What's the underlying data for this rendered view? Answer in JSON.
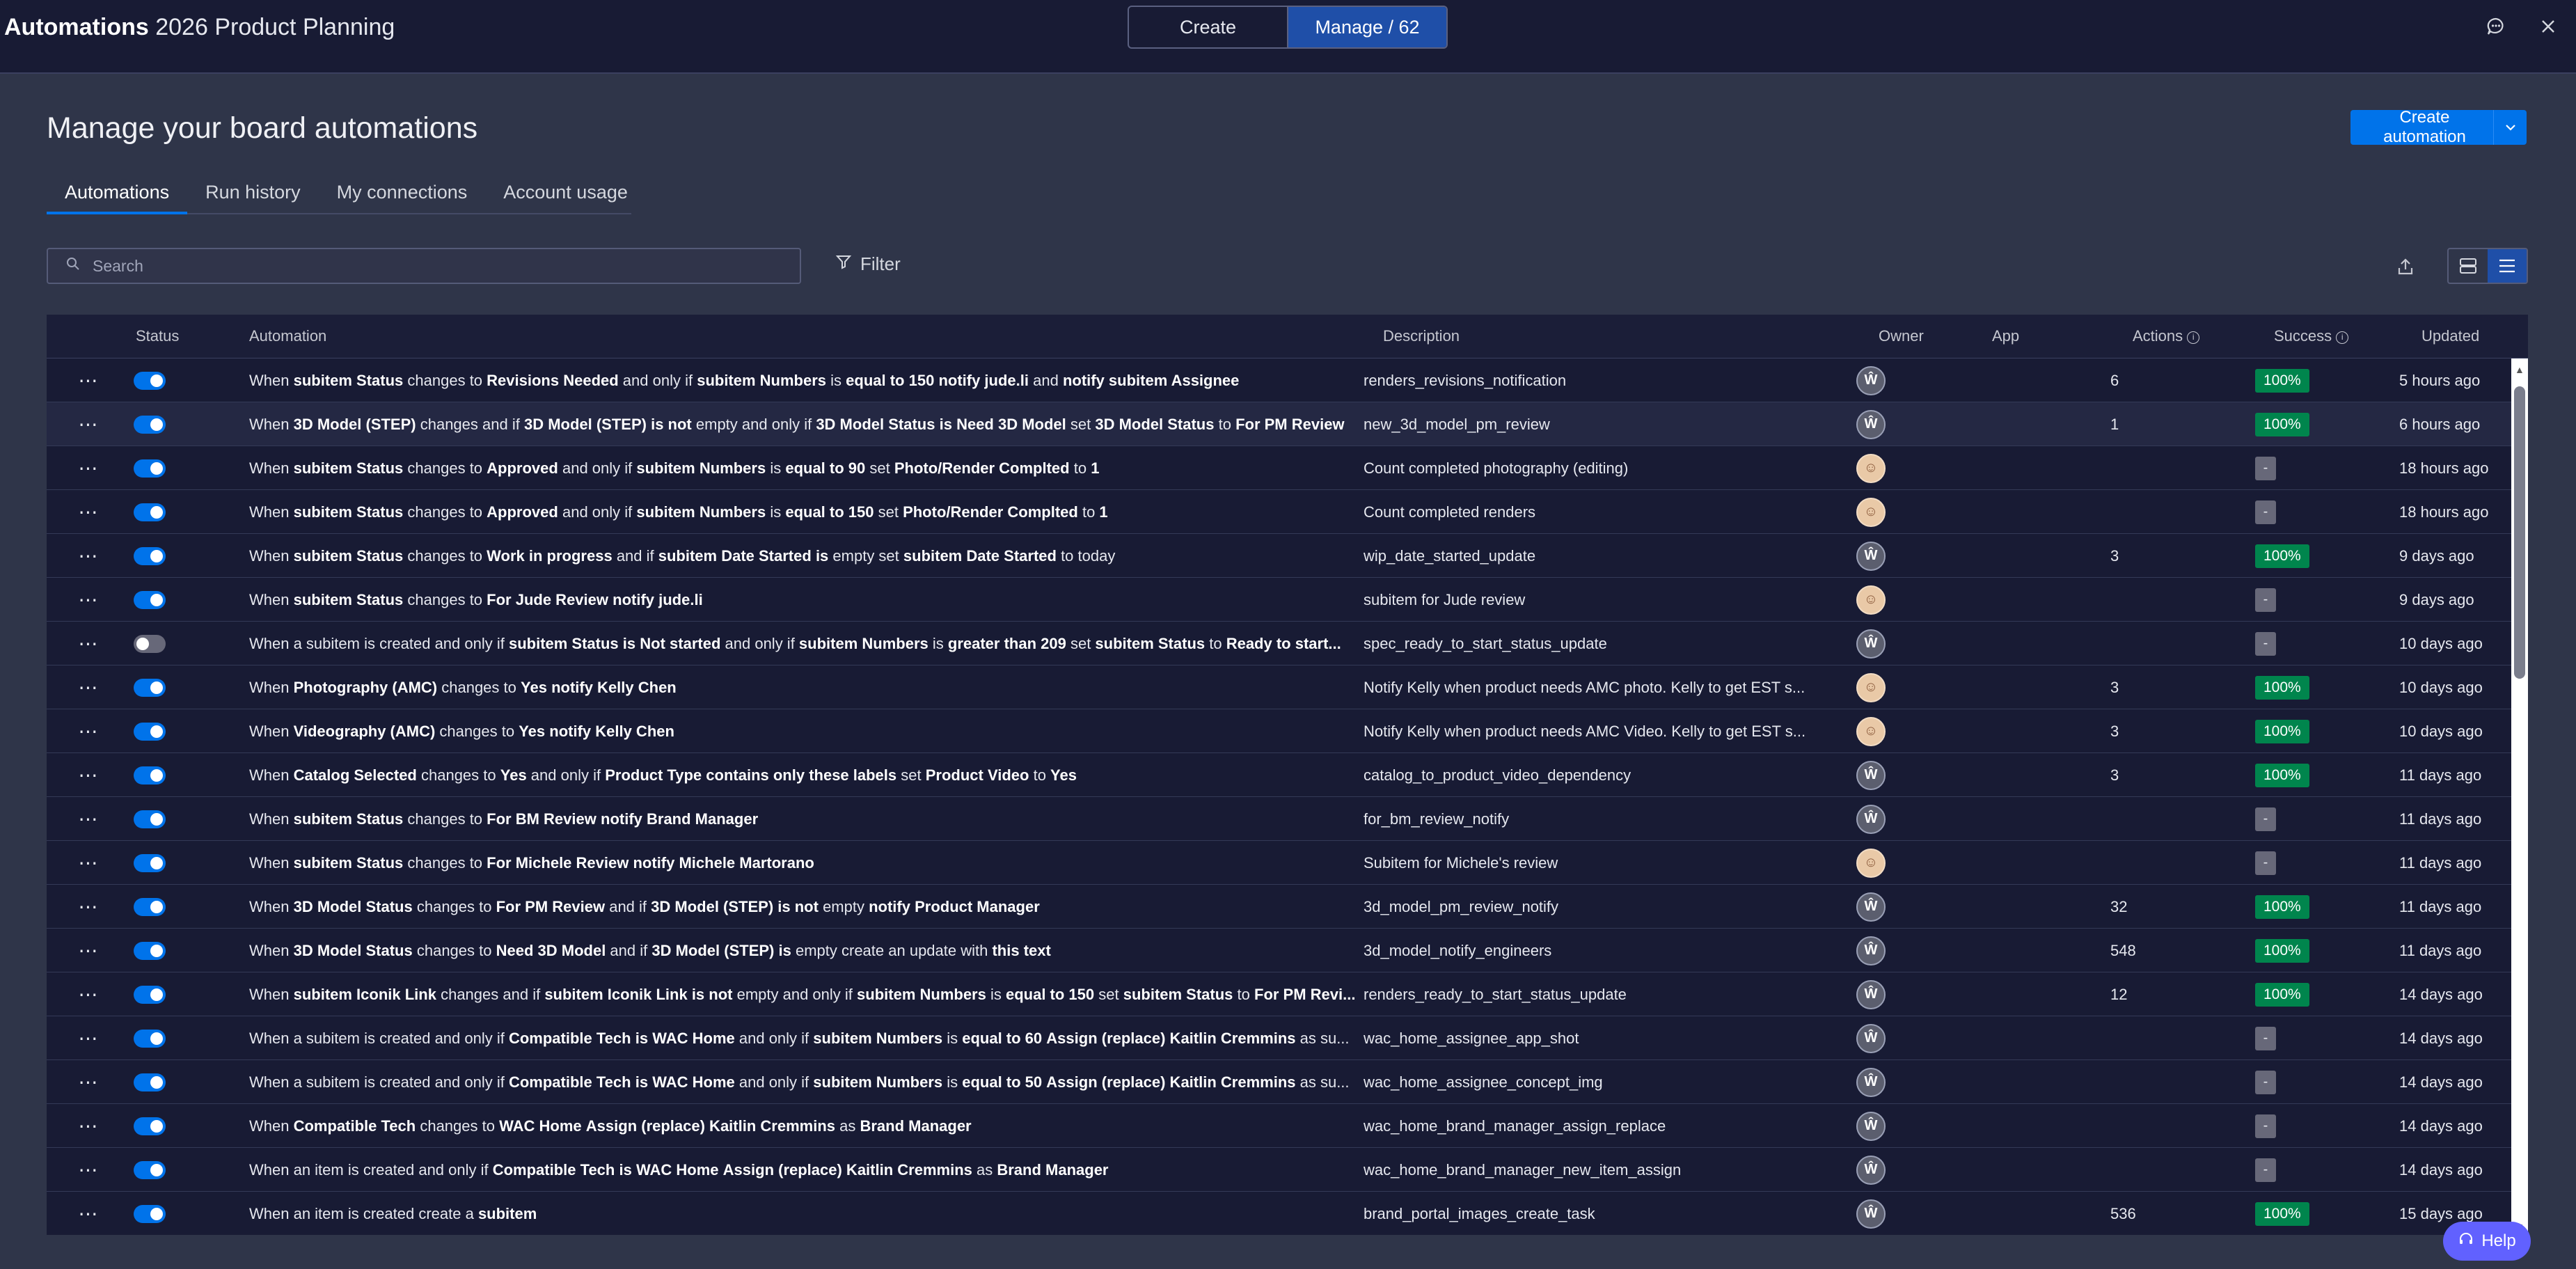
{
  "header": {
    "app_name": "Automations",
    "board_name": "2026 Product Planning",
    "create_label": "Create",
    "manage_label": "Manage / 62"
  },
  "page": {
    "title": "Manage your board automations",
    "create_button": "Create automation"
  },
  "tabs": [
    "Automations",
    "Run history",
    "My connections",
    "Account usage"
  ],
  "search": {
    "placeholder": "Search"
  },
  "filter_label": "Filter",
  "columns": {
    "status": "Status",
    "automation": "Automation",
    "description": "Description",
    "owner": "Owner",
    "app": "App",
    "actions": "Actions",
    "success": "Success",
    "updated": "Updated"
  },
  "rows": [
    {
      "on": true,
      "parts": [
        [
          "When ",
          0
        ],
        [
          "subitem Status",
          1
        ],
        [
          " changes to ",
          0
        ],
        [
          "Revisions Needed",
          1
        ],
        [
          " and only if ",
          0
        ],
        [
          "subitem Numbers",
          1
        ],
        [
          " is ",
          0
        ],
        [
          "equal to 150",
          1
        ],
        [
          " ",
          0
        ],
        [
          "notify jude.li",
          1
        ],
        [
          " and ",
          0
        ],
        [
          "notify subitem Assignee",
          1
        ]
      ],
      "description": "renders_revisions_notification",
      "owner": "logo",
      "actions": "6",
      "success": "100%",
      "updated": "5 hours ago"
    },
    {
      "on": true,
      "parts": [
        [
          "When ",
          0
        ],
        [
          "3D Model (STEP)",
          1
        ],
        [
          " changes and if ",
          0
        ],
        [
          "3D Model (STEP)",
          1
        ],
        [
          " ",
          0
        ],
        [
          "is not",
          1
        ],
        [
          " empty and only if ",
          0
        ],
        [
          "3D Model Status",
          1
        ],
        [
          " ",
          0
        ],
        [
          "is",
          1
        ],
        [
          " ",
          0
        ],
        [
          "Need 3D Model",
          1
        ],
        [
          " set ",
          0
        ],
        [
          "3D Model Status",
          1
        ],
        [
          " to ",
          0
        ],
        [
          "For PM Review",
          1
        ]
      ],
      "description": "new_3d_model_pm_review",
      "owner": "logo",
      "actions": "1",
      "success": "100%",
      "updated": "6 hours ago",
      "highlight": true
    },
    {
      "on": true,
      "parts": [
        [
          "When ",
          0
        ],
        [
          "subitem Status",
          1
        ],
        [
          " changes to ",
          0
        ],
        [
          "Approved",
          1
        ],
        [
          " and only if ",
          0
        ],
        [
          "subitem Numbers",
          1
        ],
        [
          " is ",
          0
        ],
        [
          "equal to 90",
          1
        ],
        [
          " set ",
          0
        ],
        [
          "Photo/Render Complted",
          1
        ],
        [
          " to ",
          0
        ],
        [
          "1",
          1
        ]
      ],
      "description": "Count completed photography (editing)",
      "owner": "photo",
      "actions": "",
      "success": "-",
      "updated": "18 hours ago"
    },
    {
      "on": true,
      "parts": [
        [
          "When ",
          0
        ],
        [
          "subitem Status",
          1
        ],
        [
          " changes to ",
          0
        ],
        [
          "Approved",
          1
        ],
        [
          " and only if ",
          0
        ],
        [
          "subitem Numbers",
          1
        ],
        [
          " is ",
          0
        ],
        [
          "equal to 150",
          1
        ],
        [
          " set ",
          0
        ],
        [
          "Photo/Render Complted",
          1
        ],
        [
          " to ",
          0
        ],
        [
          "1",
          1
        ]
      ],
      "description": "Count completed renders",
      "owner": "photo",
      "actions": "",
      "success": "-",
      "updated": "18 hours ago"
    },
    {
      "on": true,
      "parts": [
        [
          "When ",
          0
        ],
        [
          "subitem Status",
          1
        ],
        [
          " changes to ",
          0
        ],
        [
          "Work in progress",
          1
        ],
        [
          " and if ",
          0
        ],
        [
          "subitem Date Started",
          1
        ],
        [
          " ",
          0
        ],
        [
          "is",
          1
        ],
        [
          " empty set ",
          0
        ],
        [
          "subitem Date Started",
          1
        ],
        [
          " to today",
          0
        ]
      ],
      "description": "wip_date_started_update",
      "owner": "logo",
      "actions": "3",
      "success": "100%",
      "updated": "9 days ago"
    },
    {
      "on": true,
      "parts": [
        [
          "When ",
          0
        ],
        [
          "subitem Status",
          1
        ],
        [
          " changes to ",
          0
        ],
        [
          "For Jude Review",
          1
        ],
        [
          " ",
          0
        ],
        [
          "notify jude.li",
          1
        ]
      ],
      "description": "subitem for Jude review",
      "owner": "photo",
      "actions": "",
      "success": "-",
      "updated": "9 days ago"
    },
    {
      "on": false,
      "parts": [
        [
          "When a subitem is created and only if ",
          0
        ],
        [
          "subitem Status",
          1
        ],
        [
          " ",
          0
        ],
        [
          "is",
          1
        ],
        [
          " ",
          0
        ],
        [
          "Not started",
          1
        ],
        [
          " and only if ",
          0
        ],
        [
          "subitem Numbers",
          1
        ],
        [
          " is ",
          0
        ],
        [
          "greater than 209",
          1
        ],
        [
          " set ",
          0
        ],
        [
          "subitem Status",
          1
        ],
        [
          " to ",
          0
        ],
        [
          "Ready to start...",
          1
        ]
      ],
      "description": "spec_ready_to_start_status_update",
      "owner": "logo",
      "actions": "",
      "success": "-",
      "updated": "10 days ago"
    },
    {
      "on": true,
      "parts": [
        [
          "When ",
          0
        ],
        [
          "Photography (AMC)",
          1
        ],
        [
          " changes to ",
          0
        ],
        [
          "Yes",
          1
        ],
        [
          " ",
          0
        ],
        [
          "notify Kelly Chen",
          1
        ]
      ],
      "description": "Notify Kelly when product needs AMC photo. Kelly to get EST s...",
      "owner": "photo",
      "actions": "3",
      "success": "100%",
      "updated": "10 days ago"
    },
    {
      "on": true,
      "parts": [
        [
          "When ",
          0
        ],
        [
          "Videography (AMC)",
          1
        ],
        [
          " changes to ",
          0
        ],
        [
          "Yes",
          1
        ],
        [
          " ",
          0
        ],
        [
          "notify Kelly Chen",
          1
        ]
      ],
      "description": "Notify Kelly when product needs AMC Video. Kelly to get EST s...",
      "owner": "photo",
      "actions": "3",
      "success": "100%",
      "updated": "10 days ago"
    },
    {
      "on": true,
      "parts": [
        [
          "When ",
          0
        ],
        [
          "Catalog Selected",
          1
        ],
        [
          " changes to ",
          0
        ],
        [
          "Yes",
          1
        ],
        [
          " and only if ",
          0
        ],
        [
          "Product Type",
          1
        ],
        [
          " ",
          0
        ],
        [
          "contains only these labels",
          1
        ],
        [
          " set ",
          0
        ],
        [
          "Product Video",
          1
        ],
        [
          " to ",
          0
        ],
        [
          "Yes",
          1
        ]
      ],
      "description": "catalog_to_product_video_dependency",
      "owner": "logo",
      "actions": "3",
      "success": "100%",
      "updated": "11 days ago"
    },
    {
      "on": true,
      "parts": [
        [
          "When ",
          0
        ],
        [
          "subitem Status",
          1
        ],
        [
          " changes to ",
          0
        ],
        [
          "For BM Review",
          1
        ],
        [
          " ",
          0
        ],
        [
          "notify Brand Manager",
          1
        ]
      ],
      "description": "for_bm_review_notify",
      "owner": "logo",
      "actions": "",
      "success": "-",
      "updated": "11 days ago"
    },
    {
      "on": true,
      "parts": [
        [
          "When ",
          0
        ],
        [
          "subitem Status",
          1
        ],
        [
          " changes to ",
          0
        ],
        [
          "For Michele Review",
          1
        ],
        [
          " ",
          0
        ],
        [
          "notify Michele Martorano",
          1
        ]
      ],
      "description": "Subitem for Michele's review",
      "owner": "photo",
      "actions": "",
      "success": "-",
      "updated": "11 days ago"
    },
    {
      "on": true,
      "parts": [
        [
          "When ",
          0
        ],
        [
          "3D Model Status",
          1
        ],
        [
          " changes to ",
          0
        ],
        [
          "For PM Review",
          1
        ],
        [
          " and if ",
          0
        ],
        [
          "3D Model (STEP)",
          1
        ],
        [
          " ",
          0
        ],
        [
          "is not",
          1
        ],
        [
          " empty ",
          0
        ],
        [
          "notify Product Manager",
          1
        ]
      ],
      "description": "3d_model_pm_review_notify",
      "owner": "logo",
      "actions": "32",
      "success": "100%",
      "updated": "11 days ago"
    },
    {
      "on": true,
      "parts": [
        [
          "When ",
          0
        ],
        [
          "3D Model Status",
          1
        ],
        [
          " changes to ",
          0
        ],
        [
          "Need 3D Model",
          1
        ],
        [
          " and if ",
          0
        ],
        [
          "3D Model (STEP)",
          1
        ],
        [
          " ",
          0
        ],
        [
          "is",
          1
        ],
        [
          " empty create an update with ",
          0
        ],
        [
          "this text",
          1
        ]
      ],
      "description": "3d_model_notify_engineers",
      "owner": "logo",
      "actions": "548",
      "success": "100%",
      "updated": "11 days ago"
    },
    {
      "on": true,
      "parts": [
        [
          "When ",
          0
        ],
        [
          "subitem Iconik Link",
          1
        ],
        [
          " changes and if ",
          0
        ],
        [
          "subitem Iconik Link",
          1
        ],
        [
          " ",
          0
        ],
        [
          "is not",
          1
        ],
        [
          " empty and only if ",
          0
        ],
        [
          "subitem Numbers",
          1
        ],
        [
          " is ",
          0
        ],
        [
          "equal to 150",
          1
        ],
        [
          " set ",
          0
        ],
        [
          "subitem Status",
          1
        ],
        [
          " to ",
          0
        ],
        [
          "For PM Revi...",
          1
        ]
      ],
      "description": "renders_ready_to_start_status_update",
      "owner": "logo",
      "actions": "12",
      "success": "100%",
      "updated": "14 days ago"
    },
    {
      "on": true,
      "parts": [
        [
          "When a subitem is created and only if ",
          0
        ],
        [
          "Compatible Tech",
          1
        ],
        [
          " ",
          0
        ],
        [
          "is",
          1
        ],
        [
          " ",
          0
        ],
        [
          "WAC Home",
          1
        ],
        [
          " and only if ",
          0
        ],
        [
          "subitem Numbers",
          1
        ],
        [
          " is ",
          0
        ],
        [
          "equal to 60",
          1
        ],
        [
          " ",
          0
        ],
        [
          "Assign (replace) Kaitlin Cremmins",
          1
        ],
        [
          " as su...",
          0
        ]
      ],
      "description": "wac_home_assignee_app_shot",
      "owner": "logo",
      "actions": "",
      "success": "-",
      "updated": "14 days ago"
    },
    {
      "on": true,
      "parts": [
        [
          "When a subitem is created and only if ",
          0
        ],
        [
          "Compatible Tech",
          1
        ],
        [
          " ",
          0
        ],
        [
          "is",
          1
        ],
        [
          " ",
          0
        ],
        [
          "WAC Home",
          1
        ],
        [
          " and only if ",
          0
        ],
        [
          "subitem Numbers",
          1
        ],
        [
          " is ",
          0
        ],
        [
          "equal to 50",
          1
        ],
        [
          " ",
          0
        ],
        [
          "Assign (replace) Kaitlin Cremmins",
          1
        ],
        [
          " as su...",
          0
        ]
      ],
      "description": "wac_home_assignee_concept_img",
      "owner": "logo",
      "actions": "",
      "success": "-",
      "updated": "14 days ago"
    },
    {
      "on": true,
      "parts": [
        [
          "When ",
          0
        ],
        [
          "Compatible Tech",
          1
        ],
        [
          " changes to ",
          0
        ],
        [
          "WAC Home",
          1
        ],
        [
          " ",
          0
        ],
        [
          "Assign (replace) Kaitlin Cremmins",
          1
        ],
        [
          " as ",
          0
        ],
        [
          "Brand Manager",
          1
        ]
      ],
      "description": "wac_home_brand_manager_assign_replace",
      "owner": "logo",
      "actions": "",
      "success": "-",
      "updated": "14 days ago"
    },
    {
      "on": true,
      "parts": [
        [
          "When an item is created and only if ",
          0
        ],
        [
          "Compatible Tech",
          1
        ],
        [
          " ",
          0
        ],
        [
          "is",
          1
        ],
        [
          " ",
          0
        ],
        [
          "WAC Home",
          1
        ],
        [
          " ",
          0
        ],
        [
          "Assign (replace) Kaitlin Cremmins",
          1
        ],
        [
          " as ",
          0
        ],
        [
          "Brand Manager",
          1
        ]
      ],
      "description": "wac_home_brand_manager_new_item_assign",
      "owner": "logo",
      "actions": "",
      "success": "-",
      "updated": "14 days ago"
    },
    {
      "on": true,
      "parts": [
        [
          "When an item is created create a ",
          0
        ],
        [
          "subitem",
          1
        ]
      ],
      "description": "brand_portal_images_create_task",
      "owner": "logo",
      "actions": "536",
      "success": "100%",
      "updated": "15 days ago"
    }
  ],
  "help_label": "Help",
  "colors": {
    "accent": "#0073ea",
    "success": "#00854d",
    "topbar": "#181b34",
    "background": "#2f3549"
  }
}
